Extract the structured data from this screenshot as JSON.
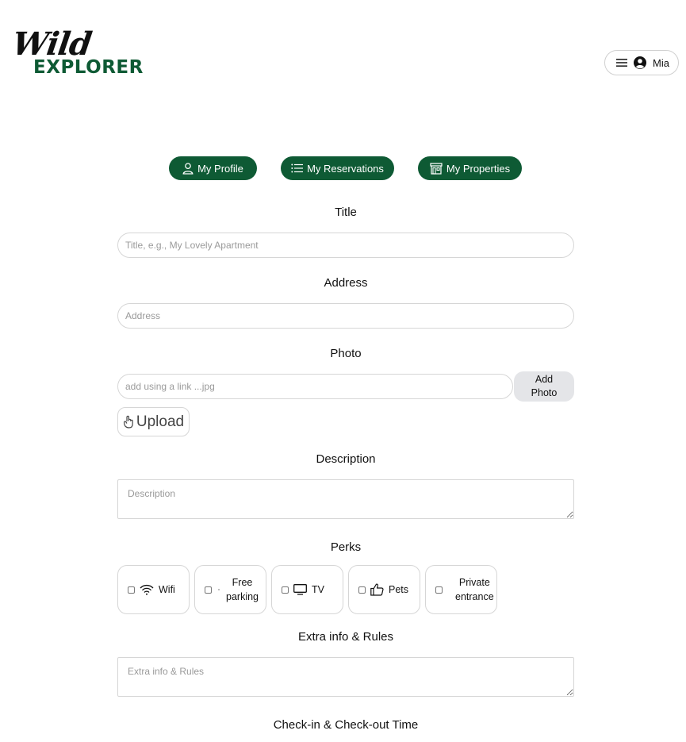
{
  "header": {
    "logo_top": "Wild",
    "logo_bottom": "EXPLORER",
    "user_name": "Mia"
  },
  "nav": {
    "profile": "My Profile",
    "reservations": "My Reservations",
    "properties": "My Properties"
  },
  "form": {
    "title_label": "Title",
    "title_placeholder": "Title, e.g., My Lovely Apartment",
    "address_label": "Address",
    "address_placeholder": "Address",
    "photo_label": "Photo",
    "photo_placeholder": "add using a link ...jpg",
    "add_photo_line1": "Add",
    "add_photo_line2": "Photo",
    "upload_label": "Upload",
    "description_label": "Description",
    "description_placeholder": "Description",
    "perks_label": "Perks",
    "extra_label": "Extra info & Rules",
    "extra_placeholder": "Extra info & Rules",
    "checkin_label": "Check-in & Check-out Time"
  },
  "perks": [
    {
      "line1": "Wifi",
      "line2": "",
      "icon": "wifi-icon"
    },
    {
      "line1": "Free",
      "line2": "parking",
      "icon": "parking-icon"
    },
    {
      "line1": "TV",
      "line2": "",
      "icon": "tv-icon"
    },
    {
      "line1": "Pets",
      "line2": "",
      "icon": "thumbs-up-icon"
    },
    {
      "line1": "Private",
      "line2": "entrance",
      "icon": "entrance-icon"
    }
  ],
  "colors": {
    "brand": "#0e5a34",
    "button_gray": "#e4e5e8"
  }
}
